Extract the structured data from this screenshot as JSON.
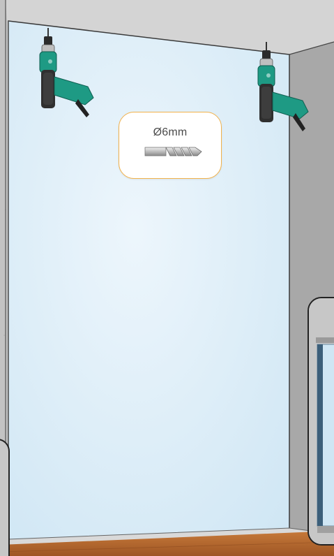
{
  "drill_bit": {
    "size_label": "Ø6mm"
  },
  "colors": {
    "wall_panel": "#d7ebf7",
    "concrete": "#bdbdbd",
    "drill_body": "#1e9a84",
    "badge_border": "#f2b24b",
    "floor_wood": "#b5682f"
  },
  "icons": [
    "drill-left-icon",
    "drill-right-icon",
    "drill-bit-icon"
  ]
}
